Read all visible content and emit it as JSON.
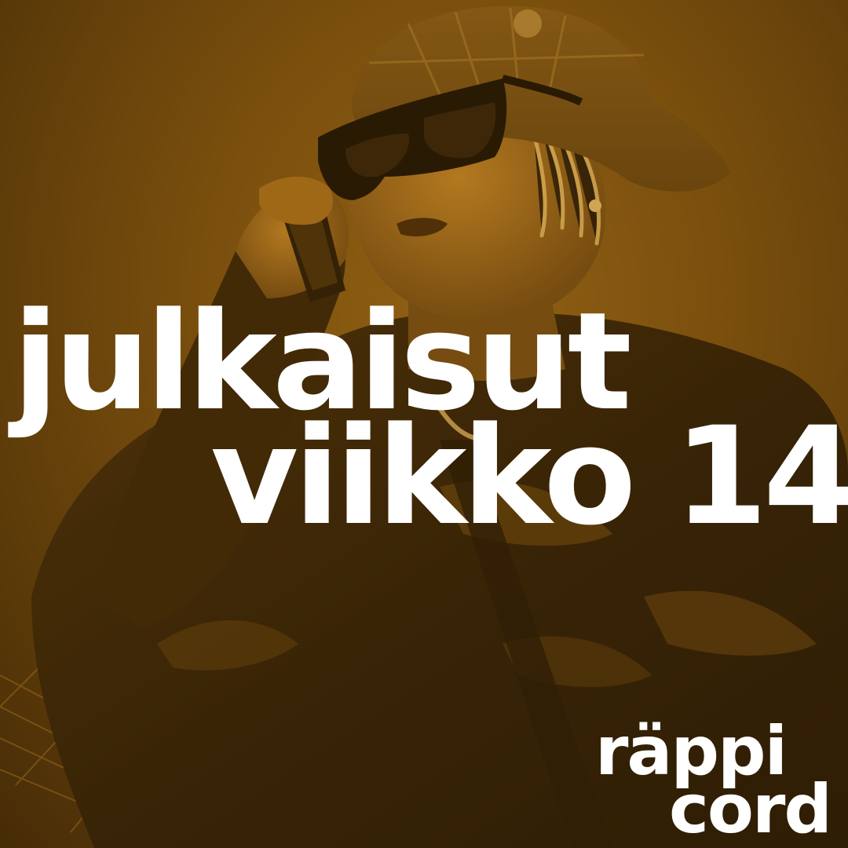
{
  "headline": {
    "line1": "julkaisut",
    "line2": "viikko 14"
  },
  "brand": {
    "line1": "räppi",
    "line2": "cord"
  },
  "photo": {
    "subject": "person in bucket hat and sunglasses talking on phone",
    "tint": "#8a5d14"
  }
}
